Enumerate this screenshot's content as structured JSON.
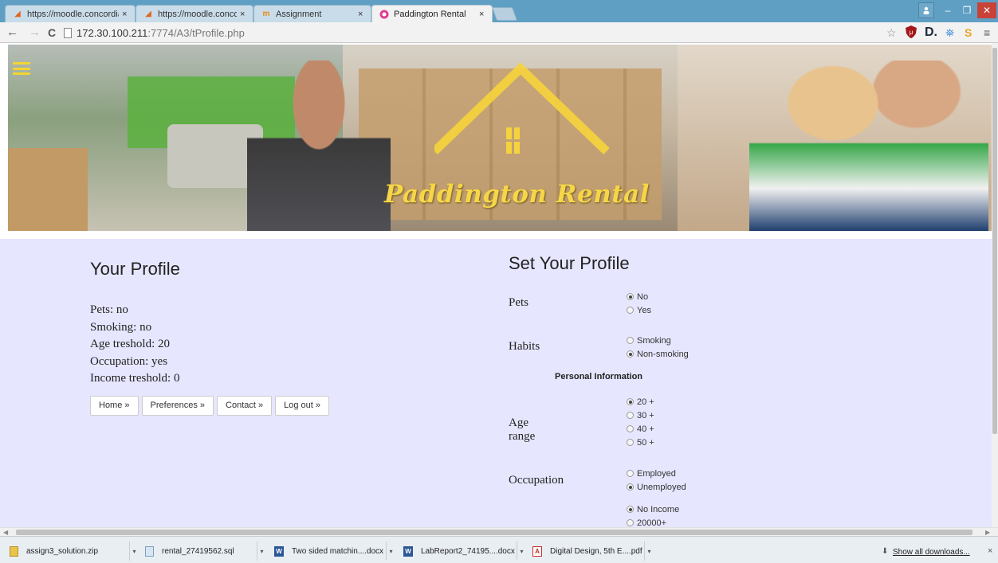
{
  "browser": {
    "tabs": [
      {
        "title": "https://moodle.concordia",
        "icon": "moodle-favicon",
        "close": "×"
      },
      {
        "title": "https://moodle.concordia",
        "icon": "moodle-favicon",
        "close": "×"
      },
      {
        "title": "Assignment",
        "icon": "moodle-logo-favicon",
        "close": "×"
      },
      {
        "title": "Paddington Rental",
        "icon": "paddington-favicon",
        "close": "×",
        "active": true
      }
    ],
    "window_controls": {
      "minimize": "–",
      "maximize": "❐",
      "close": "✕"
    },
    "url": {
      "host": "172.30.100.211",
      "path": ":7774/A3/tProfile.php"
    },
    "nav": {
      "back": "←",
      "forward": "→",
      "reload": "C"
    }
  },
  "site": {
    "brand": "Paddington Rental",
    "colors": {
      "brand_yellow": "#f6d648",
      "content_bg": "#e6e6ff"
    }
  },
  "profile": {
    "title": "Your Profile",
    "lines": [
      "Pets: no",
      "Smoking: no",
      "Age treshold: 20",
      "Occupation: yes",
      "Income treshold: 0"
    ],
    "buttons": [
      "Home »",
      "Preferences »",
      "Contact »",
      "Log out »"
    ]
  },
  "set_profile": {
    "title": "Set Your Profile",
    "pets": {
      "label": "Pets",
      "options": [
        {
          "text": "No",
          "checked": true
        },
        {
          "text": "Yes",
          "checked": false
        }
      ]
    },
    "habits": {
      "label": "Habits",
      "options": [
        {
          "text": "Smoking",
          "checked": false
        },
        {
          "text": "Non-smoking",
          "checked": true
        }
      ]
    },
    "personal_info": "Personal Information",
    "age": {
      "label": "Age range",
      "options": [
        {
          "text": "20 +",
          "checked": true
        },
        {
          "text": "30 +",
          "checked": false
        },
        {
          "text": "40 +",
          "checked": false
        },
        {
          "text": "50 +",
          "checked": false
        }
      ]
    },
    "occupation": {
      "label": "Occupation",
      "options": [
        {
          "text": "Employed",
          "checked": false
        },
        {
          "text": "Unemployed",
          "checked": true
        }
      ]
    },
    "income": {
      "options": [
        {
          "text": "No Income",
          "checked": true
        },
        {
          "text": "20000+",
          "checked": false
        }
      ]
    }
  },
  "downloads": {
    "items": [
      {
        "name": "assign3_solution.zip",
        "icon": "zip-icon"
      },
      {
        "name": "rental_27419562.sql",
        "icon": "sql-file-icon"
      },
      {
        "name": "Two sided matchin....docx",
        "icon": "word-doc-icon"
      },
      {
        "name": "LabReport2_74195....docx",
        "icon": "word-doc-icon"
      },
      {
        "name": "Digital Design, 5th E....pdf",
        "icon": "pdf-icon"
      }
    ],
    "show_all": "Show all downloads...",
    "close": "×"
  }
}
